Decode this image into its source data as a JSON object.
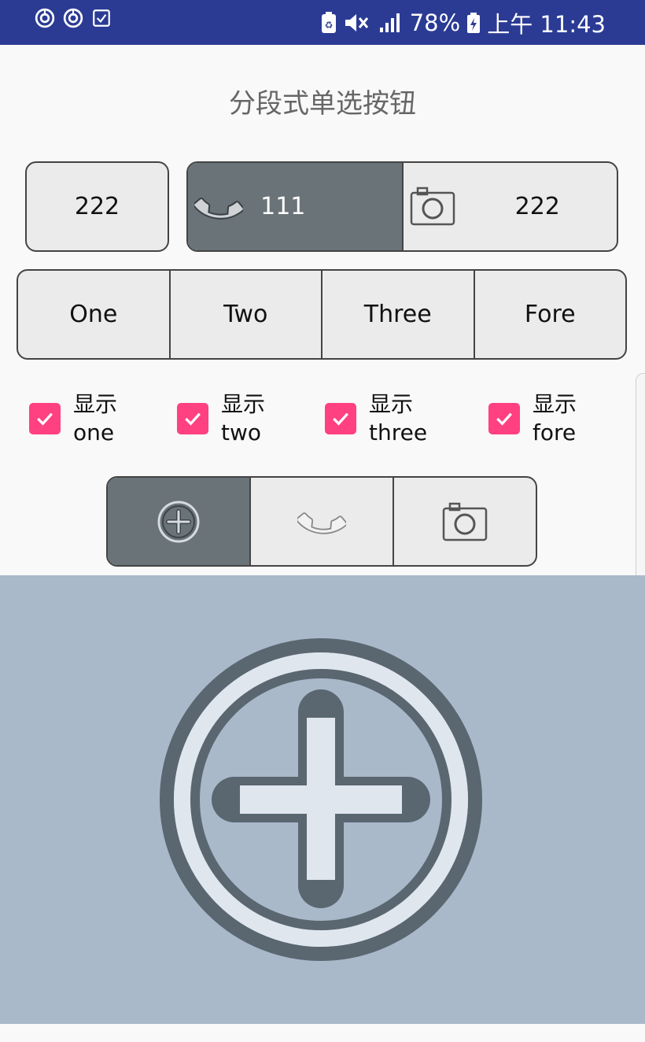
{
  "status_bar": {
    "left_icons": [
      "sync-icon",
      "sync-icon",
      "checklist-icon"
    ],
    "right_icons": [
      "battery-saver-icon",
      "mute-icon",
      "signal-icon"
    ],
    "battery": "78%",
    "time": "上午 11:43",
    "background": "#2b3b94"
  },
  "title": "分段式单选按钮",
  "row1": {
    "single_button": "222",
    "group": [
      {
        "label": "111",
        "icon": "phone-icon",
        "selected": true
      },
      {
        "label": "222",
        "icon": "camera-icon",
        "selected": false
      }
    ]
  },
  "row2": {
    "segments": [
      "One",
      "Two",
      "Three",
      "Fore"
    ]
  },
  "checkboxes": [
    {
      "line1": "显示",
      "line2": "one",
      "checked": true
    },
    {
      "line1": "显示",
      "line2": "two",
      "checked": true
    },
    {
      "line1": "显示",
      "line2": "three",
      "checked": true
    },
    {
      "line1": "显示",
      "line2": "fore",
      "checked": true
    }
  ],
  "icon_segments": [
    {
      "icon": "add-circle-icon",
      "selected": true
    },
    {
      "icon": "phone-icon",
      "selected": false
    },
    {
      "icon": "camera-icon",
      "selected": false
    }
  ],
  "preview": {
    "icon": "add-circle-icon",
    "background": "#a9b9ca"
  },
  "colors": {
    "accent": "#ff4081",
    "selected_segment": "#6a7378",
    "segment_bg": "#ebebeb"
  }
}
